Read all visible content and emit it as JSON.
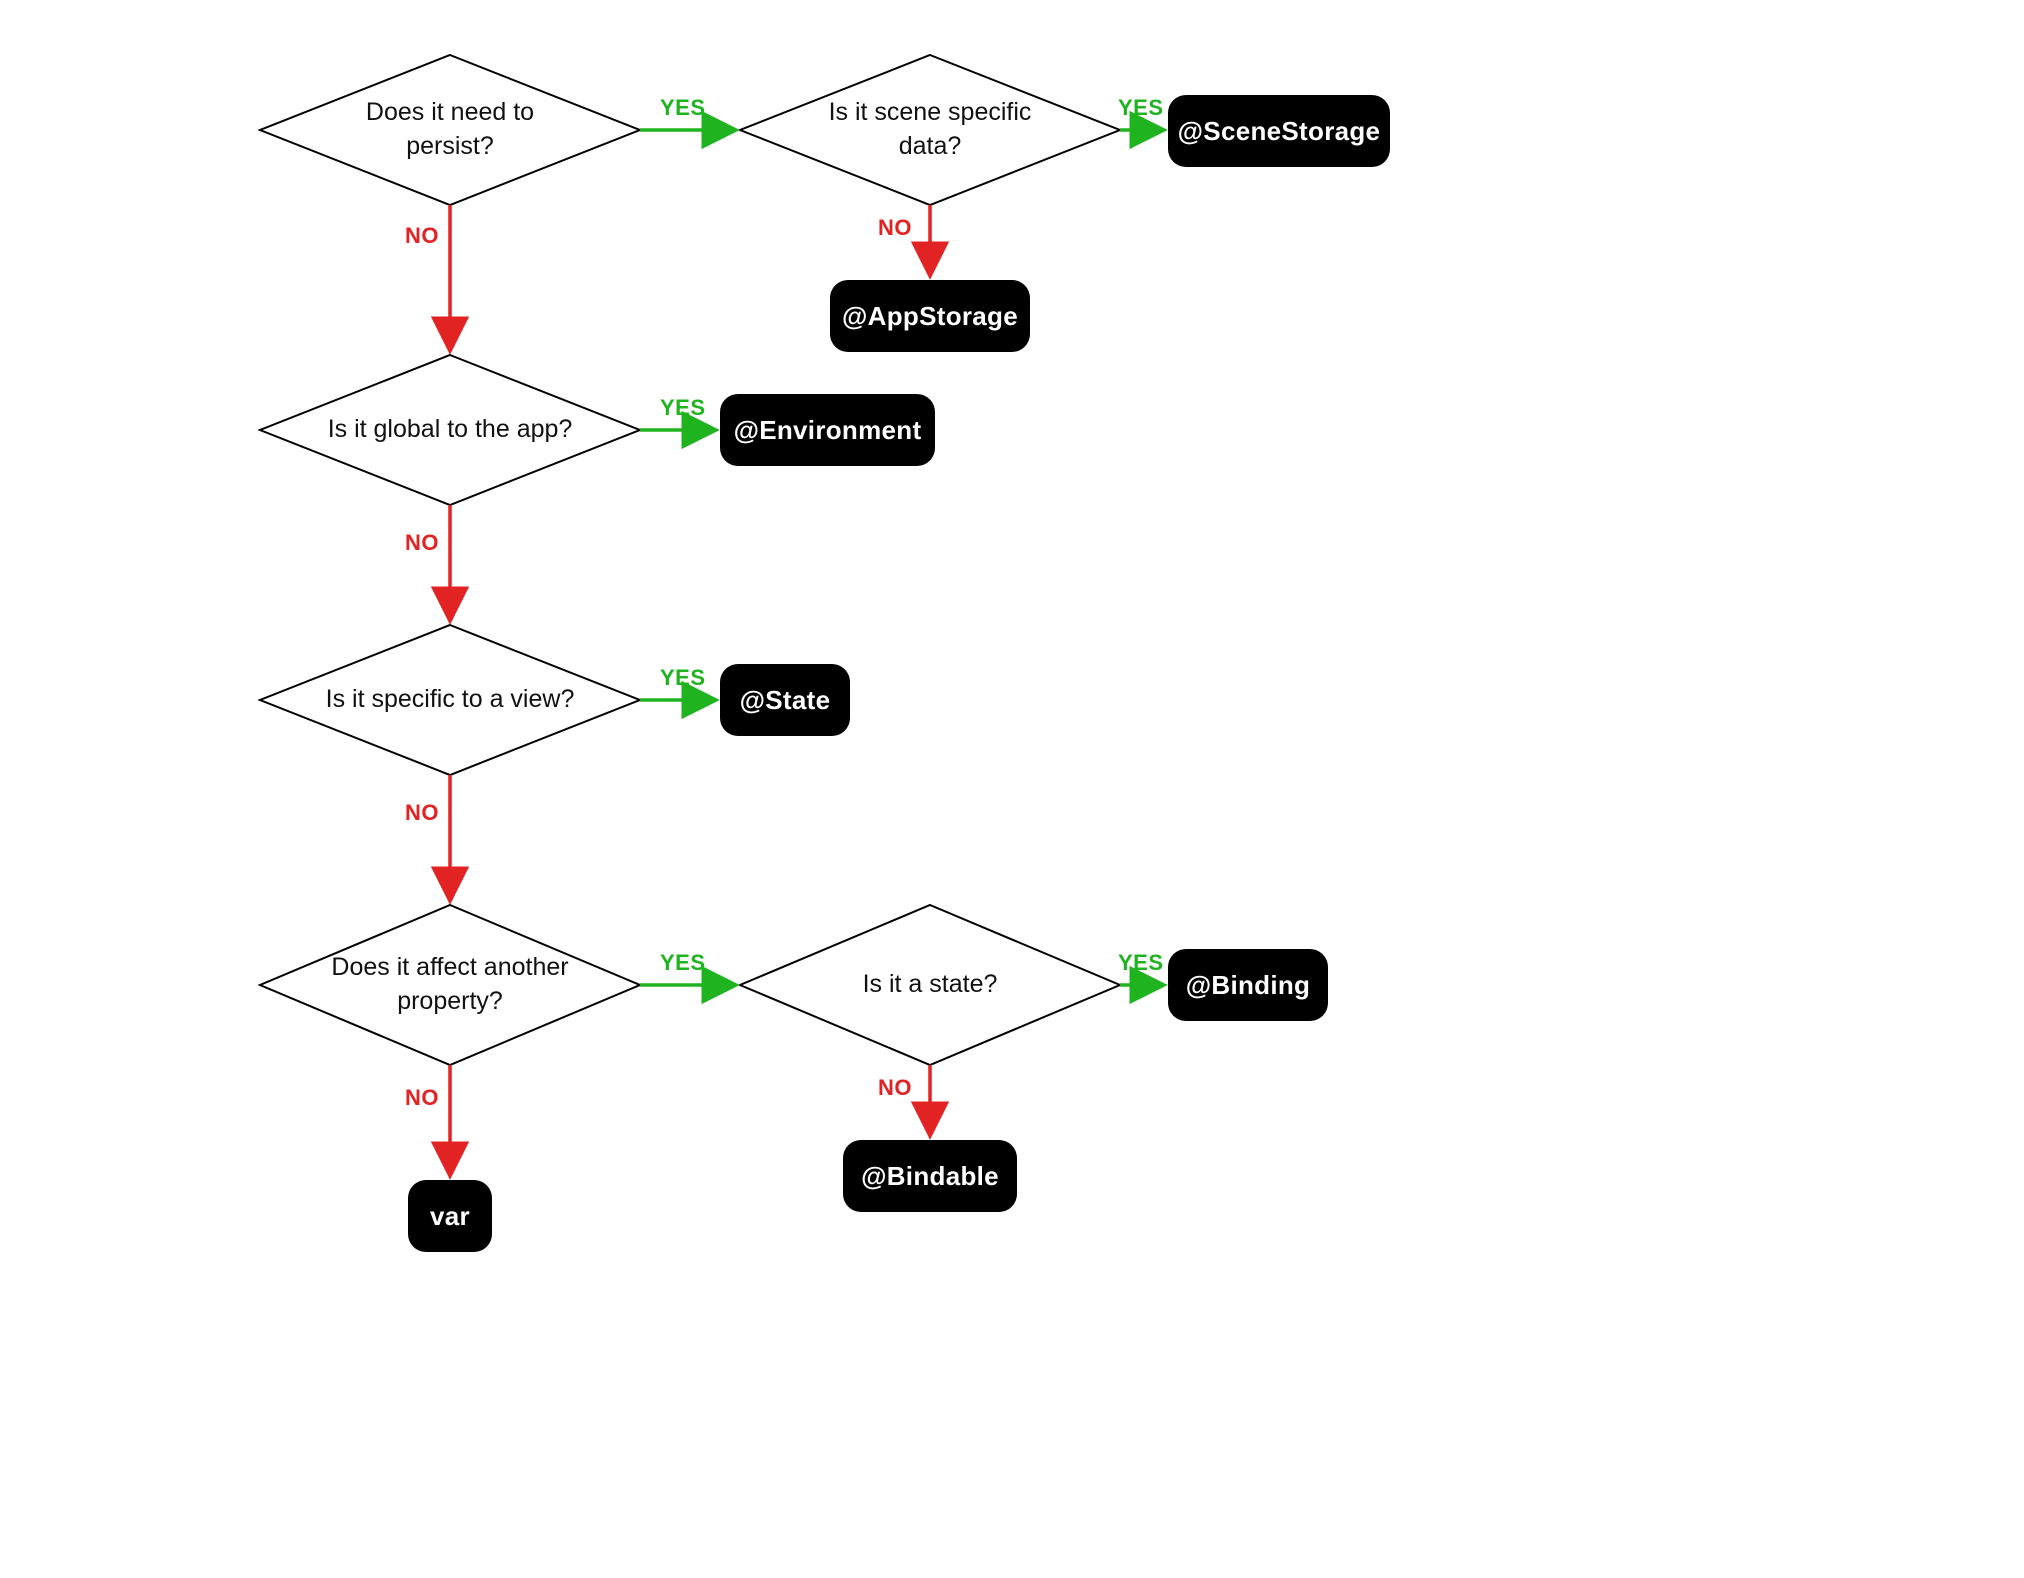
{
  "labels": {
    "yes": "YES",
    "no": "NO"
  },
  "decisions": {
    "persist": "Does it need to persist?",
    "scene_specific": "Is it scene specific data?",
    "global": "Is it global to the app?",
    "view_specific": "Is it specific to a view?",
    "affect_other": "Does it affect another property?",
    "is_state": "Is it a state?"
  },
  "results": {
    "scene_storage": "@SceneStorage",
    "app_storage": "@AppStorage",
    "environment": "@Environment",
    "state": "@State",
    "binding": "@Binding",
    "bindable": "@Bindable",
    "var": "var"
  },
  "colors": {
    "yes": "#1fb41f",
    "no": "#e22323",
    "node_fill": "#ffffff",
    "node_stroke": "#000000",
    "result_bg": "#000000",
    "result_fg": "#ffffff"
  }
}
